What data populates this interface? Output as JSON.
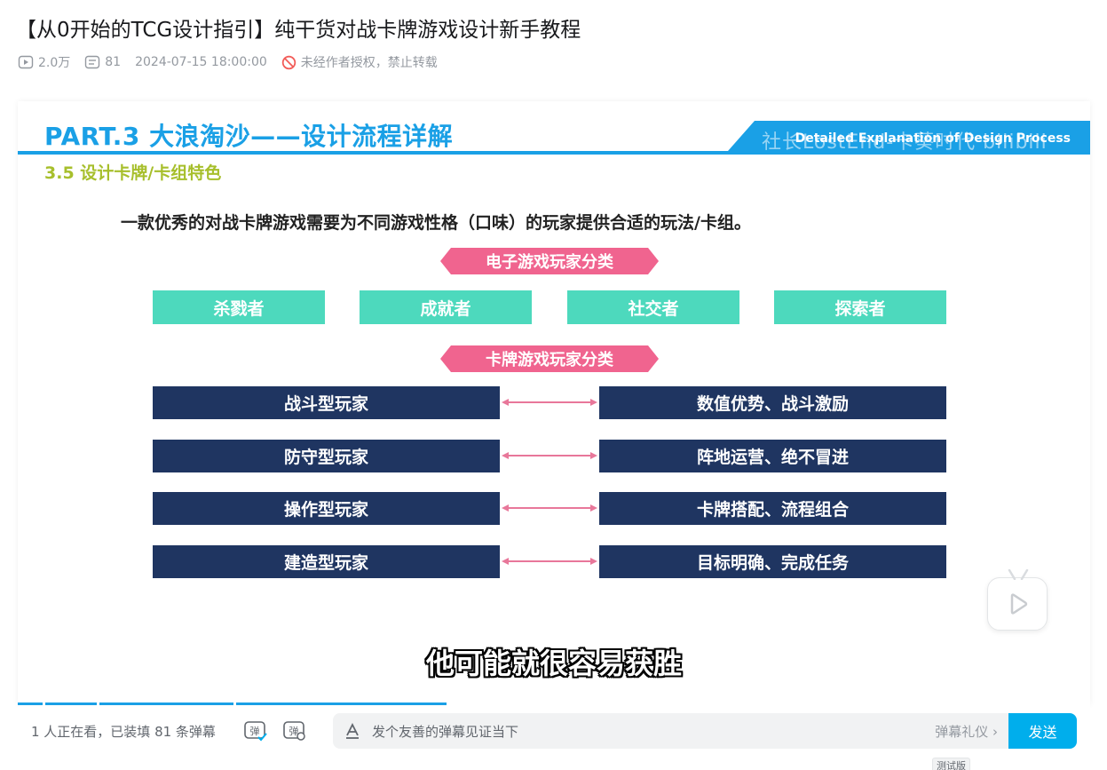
{
  "video": {
    "title": "【从0开始的TCG设计指引】纯干货对战卡牌游戏设计新手教程",
    "views": "2.0万",
    "danmaku_count": "81",
    "date": "2024-07-15 18:00:00",
    "rights": "未经作者授权，禁止转载"
  },
  "slide": {
    "part_title": "PART.3 大浪淘沙——设计流程详解",
    "banner_en": "Detailed Explanation of Design Process",
    "watermark": "社长LostEnd-卡葵时代 bilibili",
    "subtitle": "3.5 设计卡牌/卡组特色",
    "intro": "一款优秀的对战卡牌游戏需要为不同游戏性格（口味）的玩家提供合适的玩法/卡组。",
    "video_game_label": "电子游戏玩家分类",
    "player_types": [
      "杀戮者",
      "成就者",
      "社交者",
      "探索者"
    ],
    "card_game_label": "卡牌游戏玩家分类",
    "card_players": [
      {
        "type": "战斗型玩家",
        "trait": "数值优势、战斗激励"
      },
      {
        "type": "防守型玩家",
        "trait": "阵地运营、绝不冒进"
      },
      {
        "type": "操作型玩家",
        "trait": "卡牌搭配、流程组合"
      },
      {
        "type": "建造型玩家",
        "trait": "目标明确、完成任务"
      }
    ],
    "caption": "他可能就很容易获胜",
    "colors": {
      "blue": "#1aa0e6",
      "green": "#a7bf2c",
      "pink": "#f0648f",
      "teal": "#4dd9bd",
      "navy": "#1f3561"
    }
  },
  "bottom_bar": {
    "viewers_text": "1 人正在看，已装填 81 条弹幕",
    "input_placeholder": "发个友善的弹幕见证当下",
    "etiquette": "弹幕礼仪 ›",
    "send": "发送",
    "toggle_icon_text": "弹",
    "test_badge": "测试版"
  }
}
